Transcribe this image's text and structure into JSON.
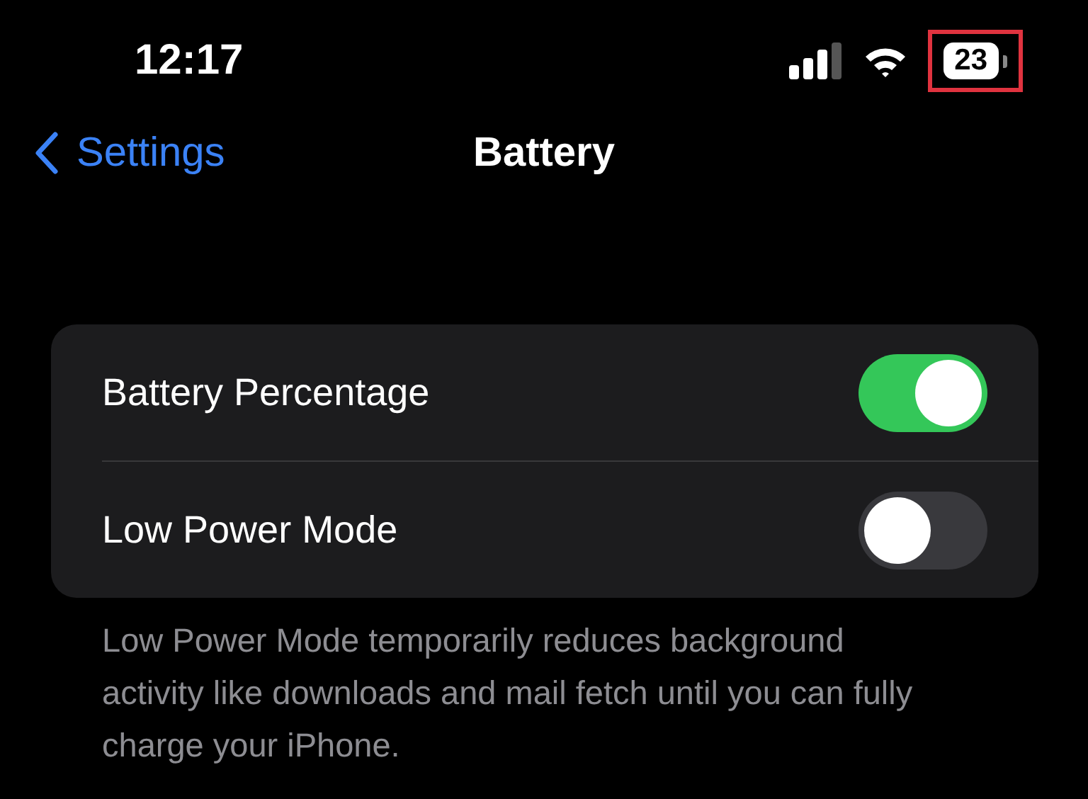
{
  "status_bar": {
    "time": "12:17",
    "battery": {
      "text": "23",
      "highlighted": true
    }
  },
  "nav": {
    "back": "Settings",
    "title": "Battery"
  },
  "settings": [
    {
      "label": "Battery Percentage",
      "on": true
    },
    {
      "label": "Low Power Mode",
      "on": false
    }
  ],
  "footer": "Low Power Mode temporarily reduces background activity like downloads and mail fetch until you can fully charge your iPhone."
}
